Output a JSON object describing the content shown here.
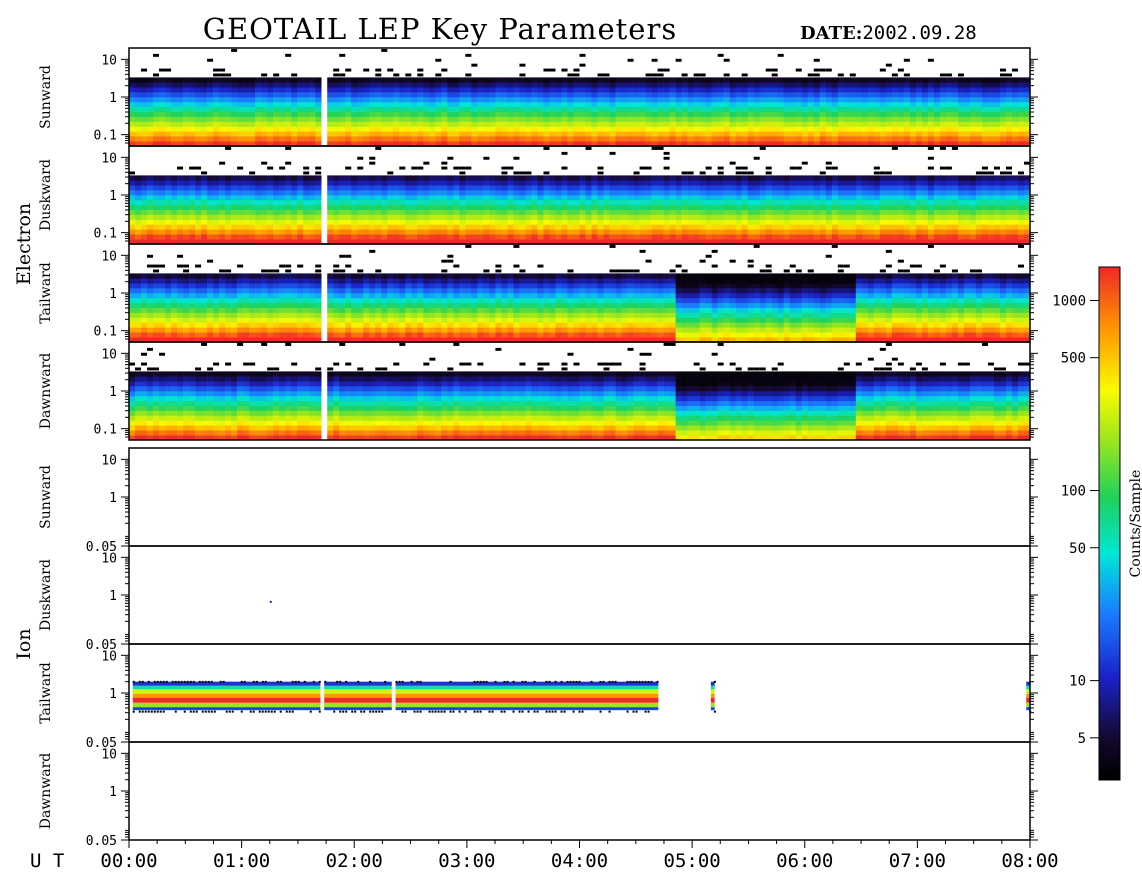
{
  "header": {
    "title": "GEOTAIL LEP Key Parameters",
    "date_label": "DATE:",
    "date_value": "2002.09.28"
  },
  "chart_data": {
    "type": "heatmap",
    "title": "GEOTAIL LEP Key Parameters",
    "date": "2002.09.28",
    "x_axis": {
      "label": "U T",
      "range": [
        "00:00",
        "08:00"
      ],
      "ticks": [
        "00:00",
        "01:00",
        "02:00",
        "03:00",
        "04:00",
        "05:00",
        "06:00",
        "07:00",
        "08:00"
      ]
    },
    "colorbar": {
      "label": "Counts/Sample",
      "scale": "log",
      "range": [
        3,
        1500
      ],
      "ticks": [
        5,
        10,
        50,
        100,
        500,
        1000
      ],
      "tick_labels": [
        "5",
        "10",
        "50",
        "100",
        "500",
        "1000"
      ]
    },
    "groups": [
      {
        "name": "Electron",
        "y_scale": "log",
        "y_range": [
          0.05,
          20
        ],
        "y_ticks": [
          0.1,
          1,
          10
        ],
        "y_tick_labels": [
          "0.1",
          "1",
          "10"
        ],
        "panels": [
          {
            "name": "Sunward",
            "base_level": 4.0,
            "dip_intervals": [],
            "data_gaps": [
              [
                "01:41",
                "01:44"
              ]
            ]
          },
          {
            "name": "Duskward",
            "base_level": 4.4,
            "dip_intervals": [],
            "data_gaps": [
              [
                "01:41",
                "01:44"
              ]
            ]
          },
          {
            "name": "Tailward",
            "base_level": 4.3,
            "dip_intervals": [
              [
                "04:51",
                "06:26"
              ]
            ],
            "data_gaps": [
              [
                "01:41",
                "01:44"
              ]
            ]
          },
          {
            "name": "Dawnward",
            "base_level": 4.0,
            "dip_intervals": [
              [
                "04:51",
                "06:26"
              ]
            ],
            "data_gaps": [
              [
                "01:41",
                "01:44"
              ]
            ]
          }
        ]
      },
      {
        "name": "Ion",
        "y_scale": "log",
        "y_range": [
          0.05,
          20
        ],
        "y_ticks": [
          0.05,
          1,
          10
        ],
        "y_tick_labels": [
          "0.05",
          "1",
          "10"
        ],
        "panels": [
          {
            "name": "Sunward",
            "coverage": []
          },
          {
            "name": "Duskward",
            "coverage": [],
            "points": [
              {
                "t": "01:15",
                "y": 0.7
              }
            ]
          },
          {
            "name": "Tailward",
            "coverage": [
              [
                "00:02",
                "01:42"
              ],
              [
                "01:44",
                "02:20"
              ],
              [
                "02:22",
                "04:42"
              ],
              [
                "05:10",
                "05:12"
              ],
              [
                "07:58",
                "08:00"
              ]
            ]
          },
          {
            "name": "Dawnward",
            "coverage": []
          }
        ]
      }
    ]
  }
}
